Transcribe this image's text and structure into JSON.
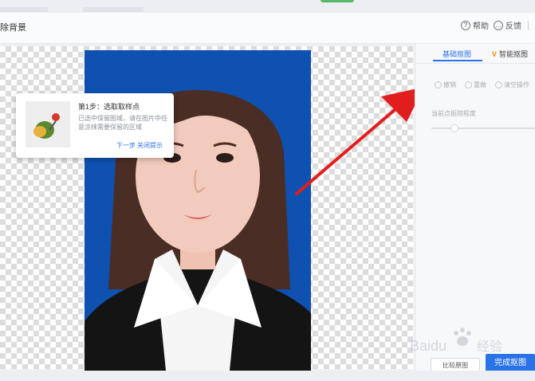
{
  "window": {
    "title": "除背景"
  },
  "toolbar": {
    "help_label": "帮助",
    "feedback_label": "反馈"
  },
  "tooltip": {
    "title": "第1步：选取取样点",
    "description": "已选中保留图域，请在图片中任意涂抹需要保留的区域",
    "next_label": "下一步",
    "close_label": "关闭提示"
  },
  "panel": {
    "tabs": [
      {
        "label": "基础抠图",
        "active": true
      },
      {
        "label": "智能抠图",
        "badge": "V",
        "active": false
      }
    ],
    "operations": [
      "撤销",
      "重做",
      "清空操作"
    ],
    "slider_label": "当前点抠除程度",
    "slider_value": 0.22
  },
  "buttons": {
    "secondary_label": "比较原图",
    "primary_label": "完成抠图"
  },
  "watermark": {
    "brand": "Baidu",
    "suffix": "经验"
  },
  "colors": {
    "accent": "#2a72e8",
    "photo_bg": "#0f51b0",
    "arrow": "#e11e1e",
    "vip": "#ff8a00"
  }
}
